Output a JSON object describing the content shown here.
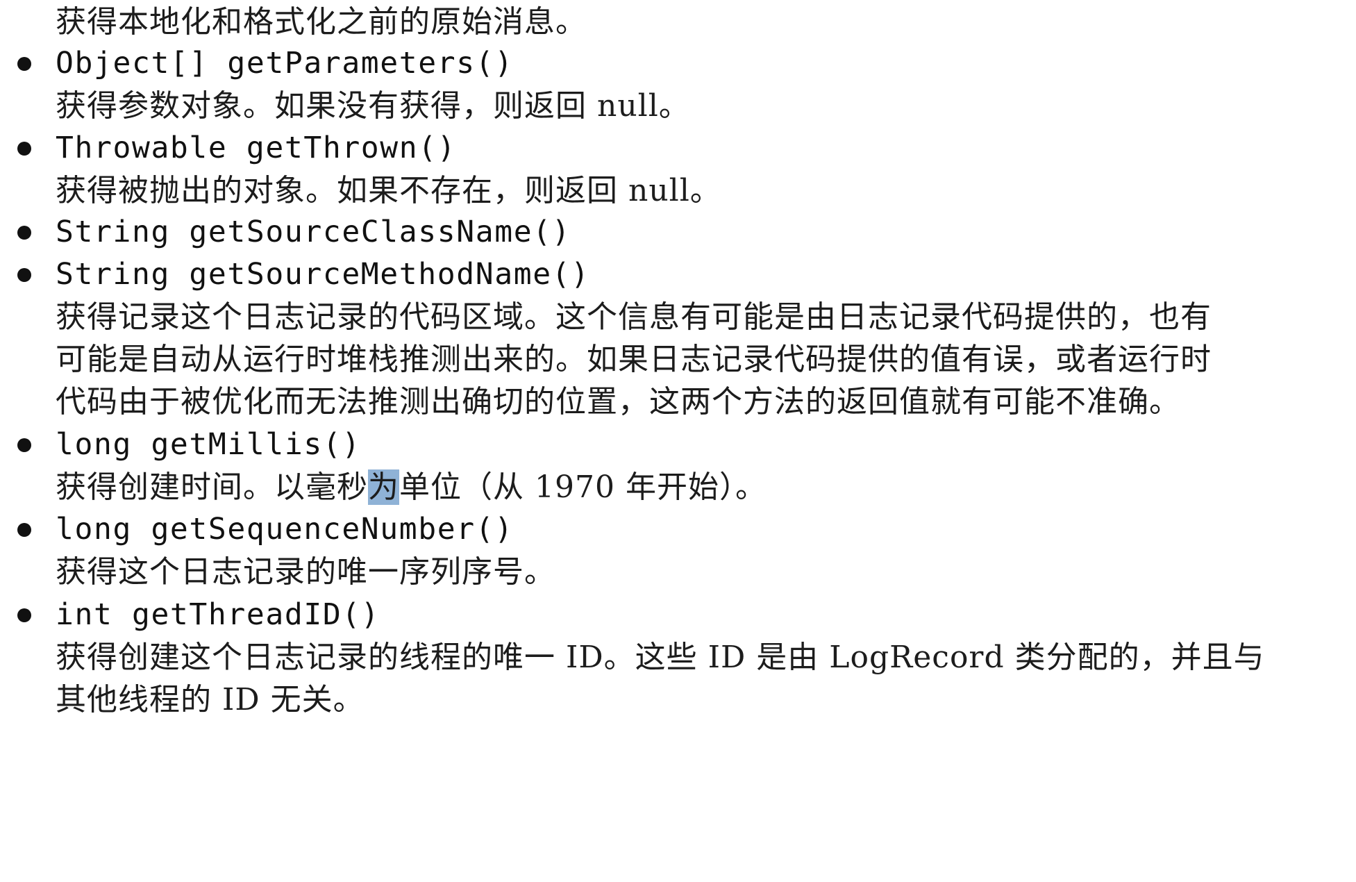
{
  "intro_line": "获得本地化和格式化之前的原始消息。",
  "methods": [
    {
      "signature": "Object[] getParameters()",
      "desc_lines": [
        "获得参数对象。如果没有获得，则返回 null。"
      ]
    },
    {
      "signature": "Throwable getThrown()",
      "desc_lines": [
        "获得被抛出的对象。如果不存在，则返回 null。"
      ]
    },
    {
      "signature": "String getSourceClassName()",
      "desc_lines": []
    },
    {
      "signature": "String getSourceMethodName()",
      "desc_lines": [
        "获得记录这个日志记录的代码区域。这个信息有可能是由日志记录代码提供的，也有",
        "可能是自动从运行时堆栈推测出来的。如果日志记录代码提供的值有误，或者运行时",
        "代码由于被优化而无法推测出确切的位置，这两个方法的返回值就有可能不准确。"
      ]
    },
    {
      "signature": "long getMillis()",
      "desc_parts": {
        "before": "获得创建时间。以毫秒",
        "highlight": "为",
        "after": "单位（从 1970 年开始）。"
      }
    },
    {
      "signature": "long getSequenceNumber()",
      "desc_lines": [
        "获得这个日志记录的唯一序列序号。"
      ]
    },
    {
      "signature": "int getThreadID()",
      "desc_lines": [
        "获得创建这个日志记录的线程的唯一 ID。这些 ID 是由 LogRecord 类分配的，并且与",
        "其他线程的 ID 无关。"
      ]
    }
  ],
  "highlight_color": "#8fb2d6"
}
